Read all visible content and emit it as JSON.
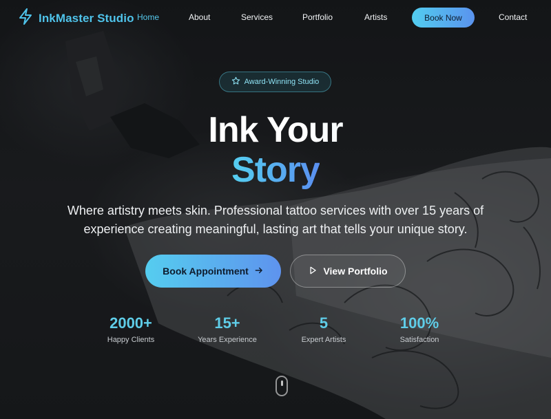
{
  "brand": {
    "name": "InkMaster Studio",
    "icon": "lightning-bolt-icon"
  },
  "nav": {
    "links": [
      "Home",
      "About",
      "Services",
      "Portfolio",
      "Artists"
    ],
    "active": "Home",
    "book_label": "Book Now",
    "contact_label": "Contact"
  },
  "hero": {
    "badge": {
      "icon": "star-icon",
      "label": "Award-Winning Studio"
    },
    "title_line1": "Ink Your",
    "title_line2": "Story",
    "subtitle": "Where artistry meets skin. Professional tattoo services with over 15 years of experience creating meaningful, lasting art that tells your unique story.",
    "primary_cta": {
      "label": "Book Appointment",
      "icon": "arrow-right-icon"
    },
    "secondary_cta": {
      "label": "View Portfolio",
      "icon": "play-icon"
    }
  },
  "stats": [
    {
      "value": "2000+",
      "label": "Happy Clients"
    },
    {
      "value": "15+",
      "label": "Years Experience"
    },
    {
      "value": "5",
      "label": "Expert Artists"
    },
    {
      "value": "100%",
      "label": "Satisfaction"
    }
  ],
  "colors": {
    "accent": "#55c9ec",
    "accent_gradient_start": "#52cdef",
    "accent_gradient_end": "#5a93ee",
    "background": "#121315"
  }
}
